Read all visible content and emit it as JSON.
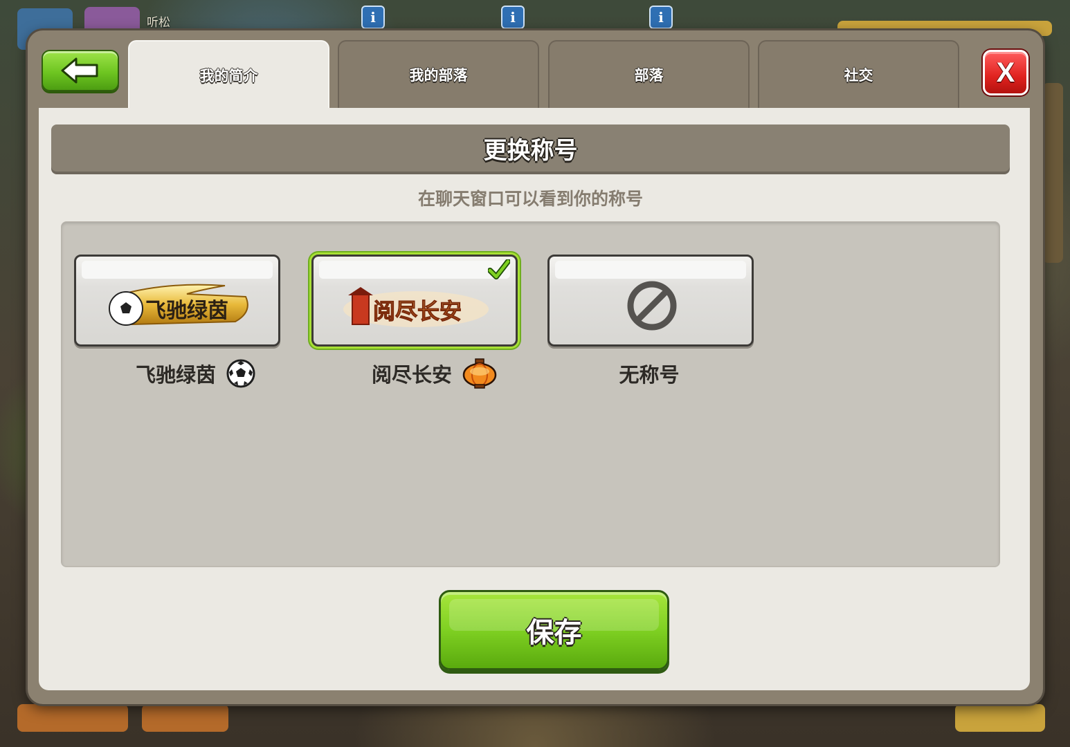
{
  "background": {
    "player_name": "听松",
    "info_icon": "i"
  },
  "tabs": [
    {
      "label": "我的简介",
      "active": true
    },
    {
      "label": "我的部落",
      "active": false
    },
    {
      "label": "部落",
      "active": false
    },
    {
      "label": "社交",
      "active": false
    }
  ],
  "close_label": "X",
  "panel": {
    "title": "更换称号",
    "subtitle": "在聊天窗口可以看到你的称号"
  },
  "titles": [
    {
      "label": "飞驰绿茵",
      "badge_text": "飞驰绿茵",
      "icon": "soccer-ball-icon",
      "selected": false
    },
    {
      "label": "阅尽长安",
      "badge_text": "阅尽长安",
      "icon": "lantern-icon",
      "selected": true
    },
    {
      "label": "无称号",
      "badge_text": "",
      "icon": "no-symbol-icon",
      "selected": false
    }
  ],
  "save_label": "保存",
  "colors": {
    "accent_green": "#7fd022",
    "close_red": "#e0221f",
    "panel_bg": "#ebe9e3",
    "tab_inactive": "#867c6c"
  }
}
